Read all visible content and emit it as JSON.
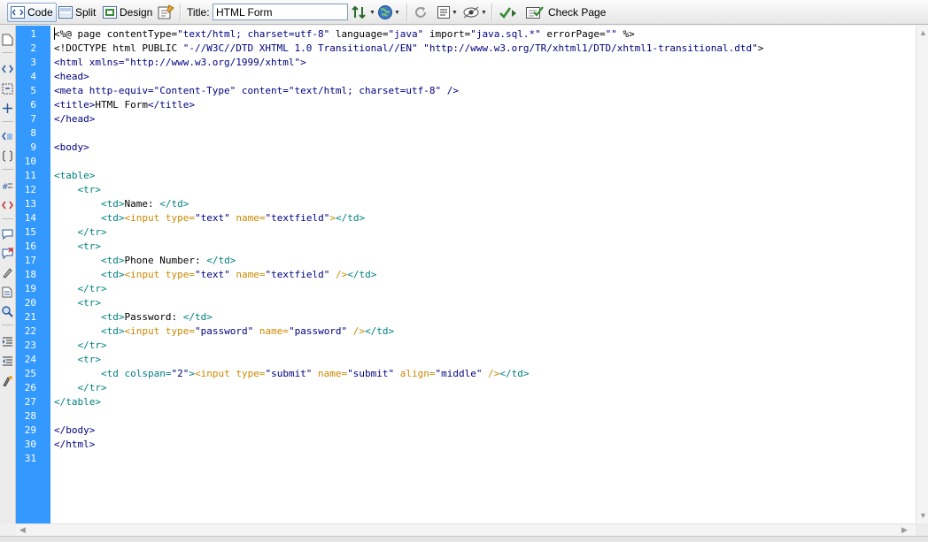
{
  "toolbar": {
    "code_label": "Code",
    "split_label": "Split",
    "design_label": "Design",
    "title_label": "Title:",
    "title_value": "HTML Form",
    "check_page_label": "Check Page",
    "active_view": "Code",
    "icons": [
      "code-view-icon",
      "split-view-icon",
      "design-view-icon",
      "live-view-icon",
      "file-transfer-icon",
      "preview-browser-icon",
      "refresh-icon",
      "view-options-icon",
      "visual-aids-icon",
      "validate-icon",
      "check-page-icon"
    ]
  },
  "editor": {
    "line_numbers": [
      "1",
      "2",
      "3",
      "4",
      "5",
      "6",
      "7",
      "8",
      "9",
      "10",
      "11",
      "12",
      "13",
      "14",
      "15",
      "16",
      "17",
      "18",
      "19",
      "20",
      "21",
      "22",
      "23",
      "24",
      "25",
      "26",
      "27",
      "28",
      "29",
      "30",
      "31"
    ],
    "lines": [
      [
        [
          "k",
          "<%@ page contentType="
        ],
        [
          "v",
          "\"text/html; charset=utf-8\""
        ],
        [
          "k",
          " language="
        ],
        [
          "v",
          "\"java\""
        ],
        [
          "k",
          " import="
        ],
        [
          "v",
          "\"java.sql.*\""
        ],
        [
          "k",
          " errorPage="
        ],
        [
          "v",
          "\"\""
        ],
        [
          "k",
          " %>"
        ]
      ],
      [
        [
          "n",
          "<!DOCTYPE html PUBLIC "
        ],
        [
          "v",
          "\"-//W3C//DTD XHTML 1.0 Transitional//EN\""
        ],
        [
          "n",
          " "
        ],
        [
          "v",
          "\"http://www.w3.org/TR/xhtml1/DTD/xhtml1-transitional.dtd\""
        ],
        [
          "n",
          ">"
        ]
      ],
      [
        [
          "v",
          "<html xmlns=\"http://www.w3.org/1999/xhtml\">"
        ]
      ],
      [
        [
          "v",
          "<head>"
        ]
      ],
      [
        [
          "v",
          "<meta http-equiv=\"Content-Type\" content=\"text/html; charset=utf-8\" />"
        ]
      ],
      [
        [
          "v",
          "<title>"
        ],
        [
          "n",
          "HTML Form"
        ],
        [
          "v",
          "</title>"
        ]
      ],
      [
        [
          "v",
          "</head>"
        ]
      ],
      [],
      [
        [
          "v",
          "<body>"
        ]
      ],
      [],
      [
        [
          "t",
          "<table>"
        ]
      ],
      [
        [
          "n",
          "    "
        ],
        [
          "t",
          "<tr>"
        ]
      ],
      [
        [
          "n",
          "        "
        ],
        [
          "t",
          "<td>"
        ],
        [
          "n",
          "Name: "
        ],
        [
          "t",
          "</td>"
        ]
      ],
      [
        [
          "n",
          "        "
        ],
        [
          "t",
          "<td>"
        ],
        [
          "a",
          "<input type="
        ],
        [
          "v",
          "\"text\""
        ],
        [
          "a",
          " name="
        ],
        [
          "v",
          "\"textfield\""
        ],
        [
          "a",
          ">"
        ],
        [
          "t",
          "</td>"
        ]
      ],
      [
        [
          "n",
          "    "
        ],
        [
          "t",
          "</tr>"
        ]
      ],
      [
        [
          "n",
          "    "
        ],
        [
          "t",
          "<tr>"
        ]
      ],
      [
        [
          "n",
          "        "
        ],
        [
          "t",
          "<td>"
        ],
        [
          "n",
          "Phone Number: "
        ],
        [
          "t",
          "</td>"
        ]
      ],
      [
        [
          "n",
          "        "
        ],
        [
          "t",
          "<td>"
        ],
        [
          "a",
          "<input type="
        ],
        [
          "v",
          "\"text\""
        ],
        [
          "a",
          " name="
        ],
        [
          "v",
          "\"textfield\""
        ],
        [
          "a",
          " />"
        ],
        [
          "t",
          "</td>"
        ]
      ],
      [
        [
          "n",
          "    "
        ],
        [
          "t",
          "</tr>"
        ]
      ],
      [
        [
          "n",
          "    "
        ],
        [
          "t",
          "<tr>"
        ]
      ],
      [
        [
          "n",
          "        "
        ],
        [
          "t",
          "<td>"
        ],
        [
          "n",
          "Password: "
        ],
        [
          "t",
          "</td>"
        ]
      ],
      [
        [
          "n",
          "        "
        ],
        [
          "t",
          "<td>"
        ],
        [
          "a",
          "<input type="
        ],
        [
          "v",
          "\"password\""
        ],
        [
          "a",
          " name="
        ],
        [
          "v",
          "\"password\""
        ],
        [
          "a",
          " />"
        ],
        [
          "t",
          "</td>"
        ]
      ],
      [
        [
          "n",
          "    "
        ],
        [
          "t",
          "</tr>"
        ]
      ],
      [
        [
          "n",
          "    "
        ],
        [
          "t",
          "<tr>"
        ]
      ],
      [
        [
          "n",
          "        "
        ],
        [
          "t",
          "<td colspan="
        ],
        [
          "v",
          "\"2\""
        ],
        [
          "t",
          ">"
        ],
        [
          "a",
          "<input type="
        ],
        [
          "v",
          "\"submit\""
        ],
        [
          "a",
          " name="
        ],
        [
          "v",
          "\"submit\""
        ],
        [
          "a",
          " align="
        ],
        [
          "v",
          "\"middle\""
        ],
        [
          "a",
          " />"
        ],
        [
          "t",
          "</td>"
        ]
      ],
      [
        [
          "n",
          "    "
        ],
        [
          "t",
          "</tr>"
        ]
      ],
      [
        [
          "t",
          "</table>"
        ]
      ],
      [],
      [
        [
          "v",
          "</body>"
        ]
      ],
      [
        [
          "v",
          "</html>"
        ]
      ],
      []
    ]
  },
  "colors": {
    "gutter": "#3399ff",
    "tag_teal": "#008080",
    "input_orange": "#cc8800",
    "value_navy": "#000080"
  }
}
